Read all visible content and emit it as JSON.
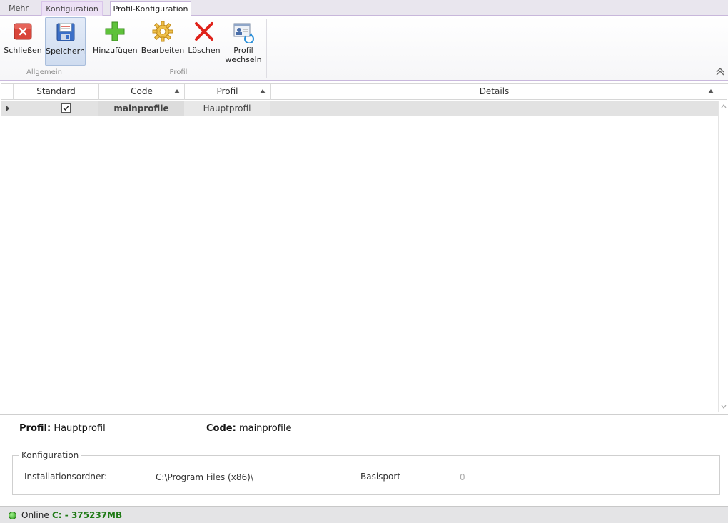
{
  "tabs": [
    "Mehr",
    "Konfiguration",
    "Profil-Konfiguration"
  ],
  "ribbon": {
    "groups": [
      {
        "label": "Allgemein",
        "buttons": [
          {
            "label": "Schließen",
            "icon": "close-icon"
          },
          {
            "label": "Speichern",
            "icon": "save-icon"
          }
        ]
      },
      {
        "label": "Profil",
        "buttons": [
          {
            "label": "Hinzufügen",
            "icon": "add-icon"
          },
          {
            "label": "Bearbeiten",
            "icon": "gear-icon"
          },
          {
            "label": "Löschen",
            "icon": "delete-icon"
          },
          {
            "label": "Profil",
            "label2": "wechseln",
            "icon": "switch-profile-icon"
          }
        ]
      }
    ]
  },
  "grid": {
    "columns": [
      "Standard",
      "Code",
      "Profil",
      "Details"
    ],
    "rows": [
      {
        "standard": true,
        "code": "mainprofile",
        "profil": "Hauptprofil",
        "details": ""
      }
    ]
  },
  "details": {
    "profil_label": "Profil:",
    "profil_value": "Hauptprofil",
    "code_label": "Code:",
    "code_value": "mainprofile",
    "group_title": "Konfiguration",
    "install_label": "Installationsordner:",
    "install_value": "C:\\Program Files (x86)\\",
    "port_label": "Basisport",
    "port_value": "0"
  },
  "status": {
    "online": "Online",
    "disk": "C: - 375237MB"
  },
  "colors": {
    "accent": "#c9b8dd",
    "online": "#2c9a1c",
    "disk_text": "#1f7a16"
  }
}
